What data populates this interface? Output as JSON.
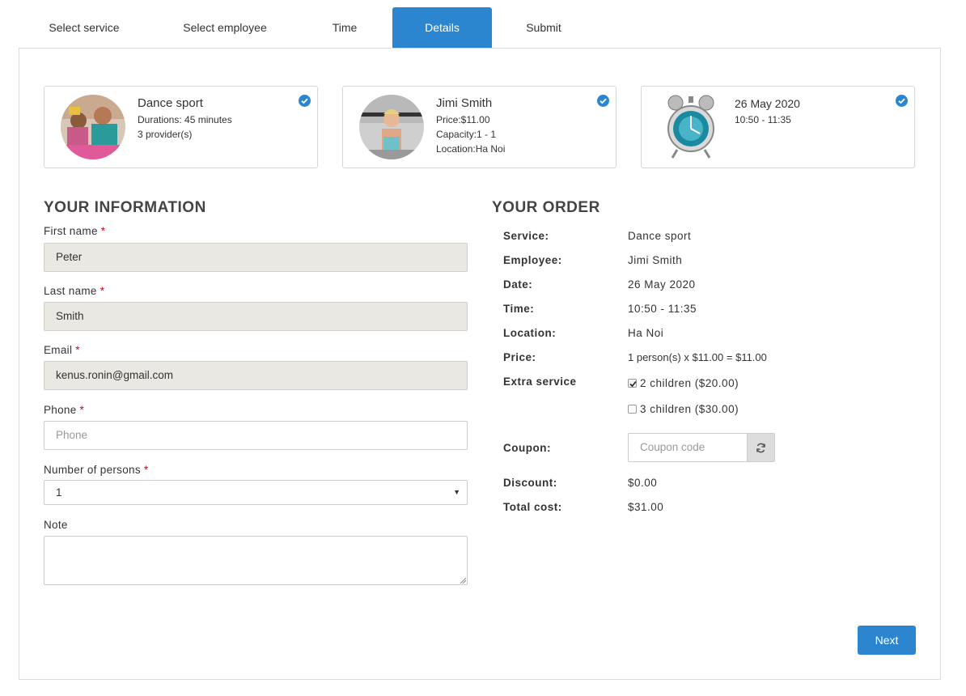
{
  "tabs": [
    {
      "label": "Select service",
      "active": false
    },
    {
      "label": "Select employee",
      "active": false
    },
    {
      "label": "Time",
      "active": false
    },
    {
      "label": "Details",
      "active": true
    },
    {
      "label": "Submit",
      "active": false
    }
  ],
  "cards": {
    "service": {
      "title": "Dance sport",
      "lines": [
        "Durations: 45 minutes",
        "3 provider(s)"
      ]
    },
    "employee": {
      "title": "Jimi Smith",
      "lines": [
        "Price:$11.00",
        "Capacity:1 - 1",
        "Location:Ha Noi"
      ]
    },
    "time": {
      "title": "26 May 2020",
      "lines": [
        "10:50 - 11:35"
      ]
    },
    "check_icon": "check-circle-icon"
  },
  "info": {
    "heading": "YOUR INFORMATION",
    "required_mark": "*",
    "first_name": {
      "label": "First name",
      "value": "Peter"
    },
    "last_name": {
      "label": "Last name",
      "value": "Smith"
    },
    "email": {
      "label": "Email",
      "value": "kenus.ronin@gmail.com"
    },
    "phone": {
      "label": "Phone",
      "value": "",
      "placeholder": "Phone"
    },
    "persons": {
      "label": "Number of persons",
      "value": "1"
    },
    "note": {
      "label": "Note",
      "value": ""
    }
  },
  "order": {
    "heading": "YOUR ORDER",
    "rows": {
      "service": {
        "label": "Service:",
        "value": "Dance sport"
      },
      "employee": {
        "label": "Employee:",
        "value": "Jimi Smith"
      },
      "date": {
        "label": "Date:",
        "value": "26 May 2020"
      },
      "time": {
        "label": "Time:",
        "value": "10:50 - 11:35"
      },
      "location": {
        "label": "Location:",
        "value": "Ha Noi"
      },
      "price": {
        "label": "Price:",
        "value": "1 person(s) x $11.00 = $11.00"
      }
    },
    "extra": {
      "label": "Extra service",
      "options": [
        {
          "label": "2 children ($20.00)",
          "checked": true
        },
        {
          "label": "3 children ($30.00)",
          "checked": false
        }
      ]
    },
    "coupon": {
      "label": "Coupon:",
      "placeholder": "Coupon code",
      "icon": "refresh-icon"
    },
    "discount": {
      "label": "Discount:",
      "value": "$0.00"
    },
    "total": {
      "label": "Total cost:",
      "value": "$31.00"
    }
  },
  "next_label": "Next",
  "colors": {
    "accent": "#2b86cf",
    "filled_input": "#e9e8e2",
    "required": "#d0021b"
  }
}
